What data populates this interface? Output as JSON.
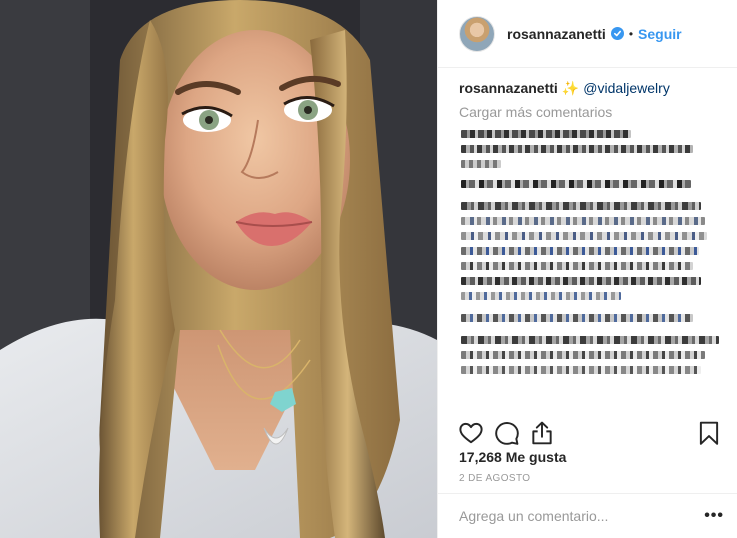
{
  "post": {
    "photo_icon": "selfie-photo",
    "alt": "rosannazanetti"
  },
  "header": {
    "username": "rosannazanetti",
    "verified_icon": "verified-badge-icon",
    "separator": "•",
    "follow_label": "Seguir"
  },
  "caption": {
    "username": "rosannazanetti",
    "emoji": "✨",
    "mention": "@vidaljewelry"
  },
  "comments": {
    "load_more": "Cargar más comentarios"
  },
  "actions": {
    "like_icon": "heart-icon",
    "comment_icon": "comment-icon",
    "share_icon": "share-icon",
    "save_icon": "bookmark-icon"
  },
  "likes": {
    "count_text": "17,268 Me gusta"
  },
  "date": {
    "text": "2 DE AGOSTO"
  },
  "comment_box": {
    "placeholder": "Agrega un comentario...",
    "more_label": "•••"
  },
  "colors": {
    "accent": "#3897f0",
    "mention": "#003569",
    "muted": "#999999",
    "text": "#262626"
  }
}
